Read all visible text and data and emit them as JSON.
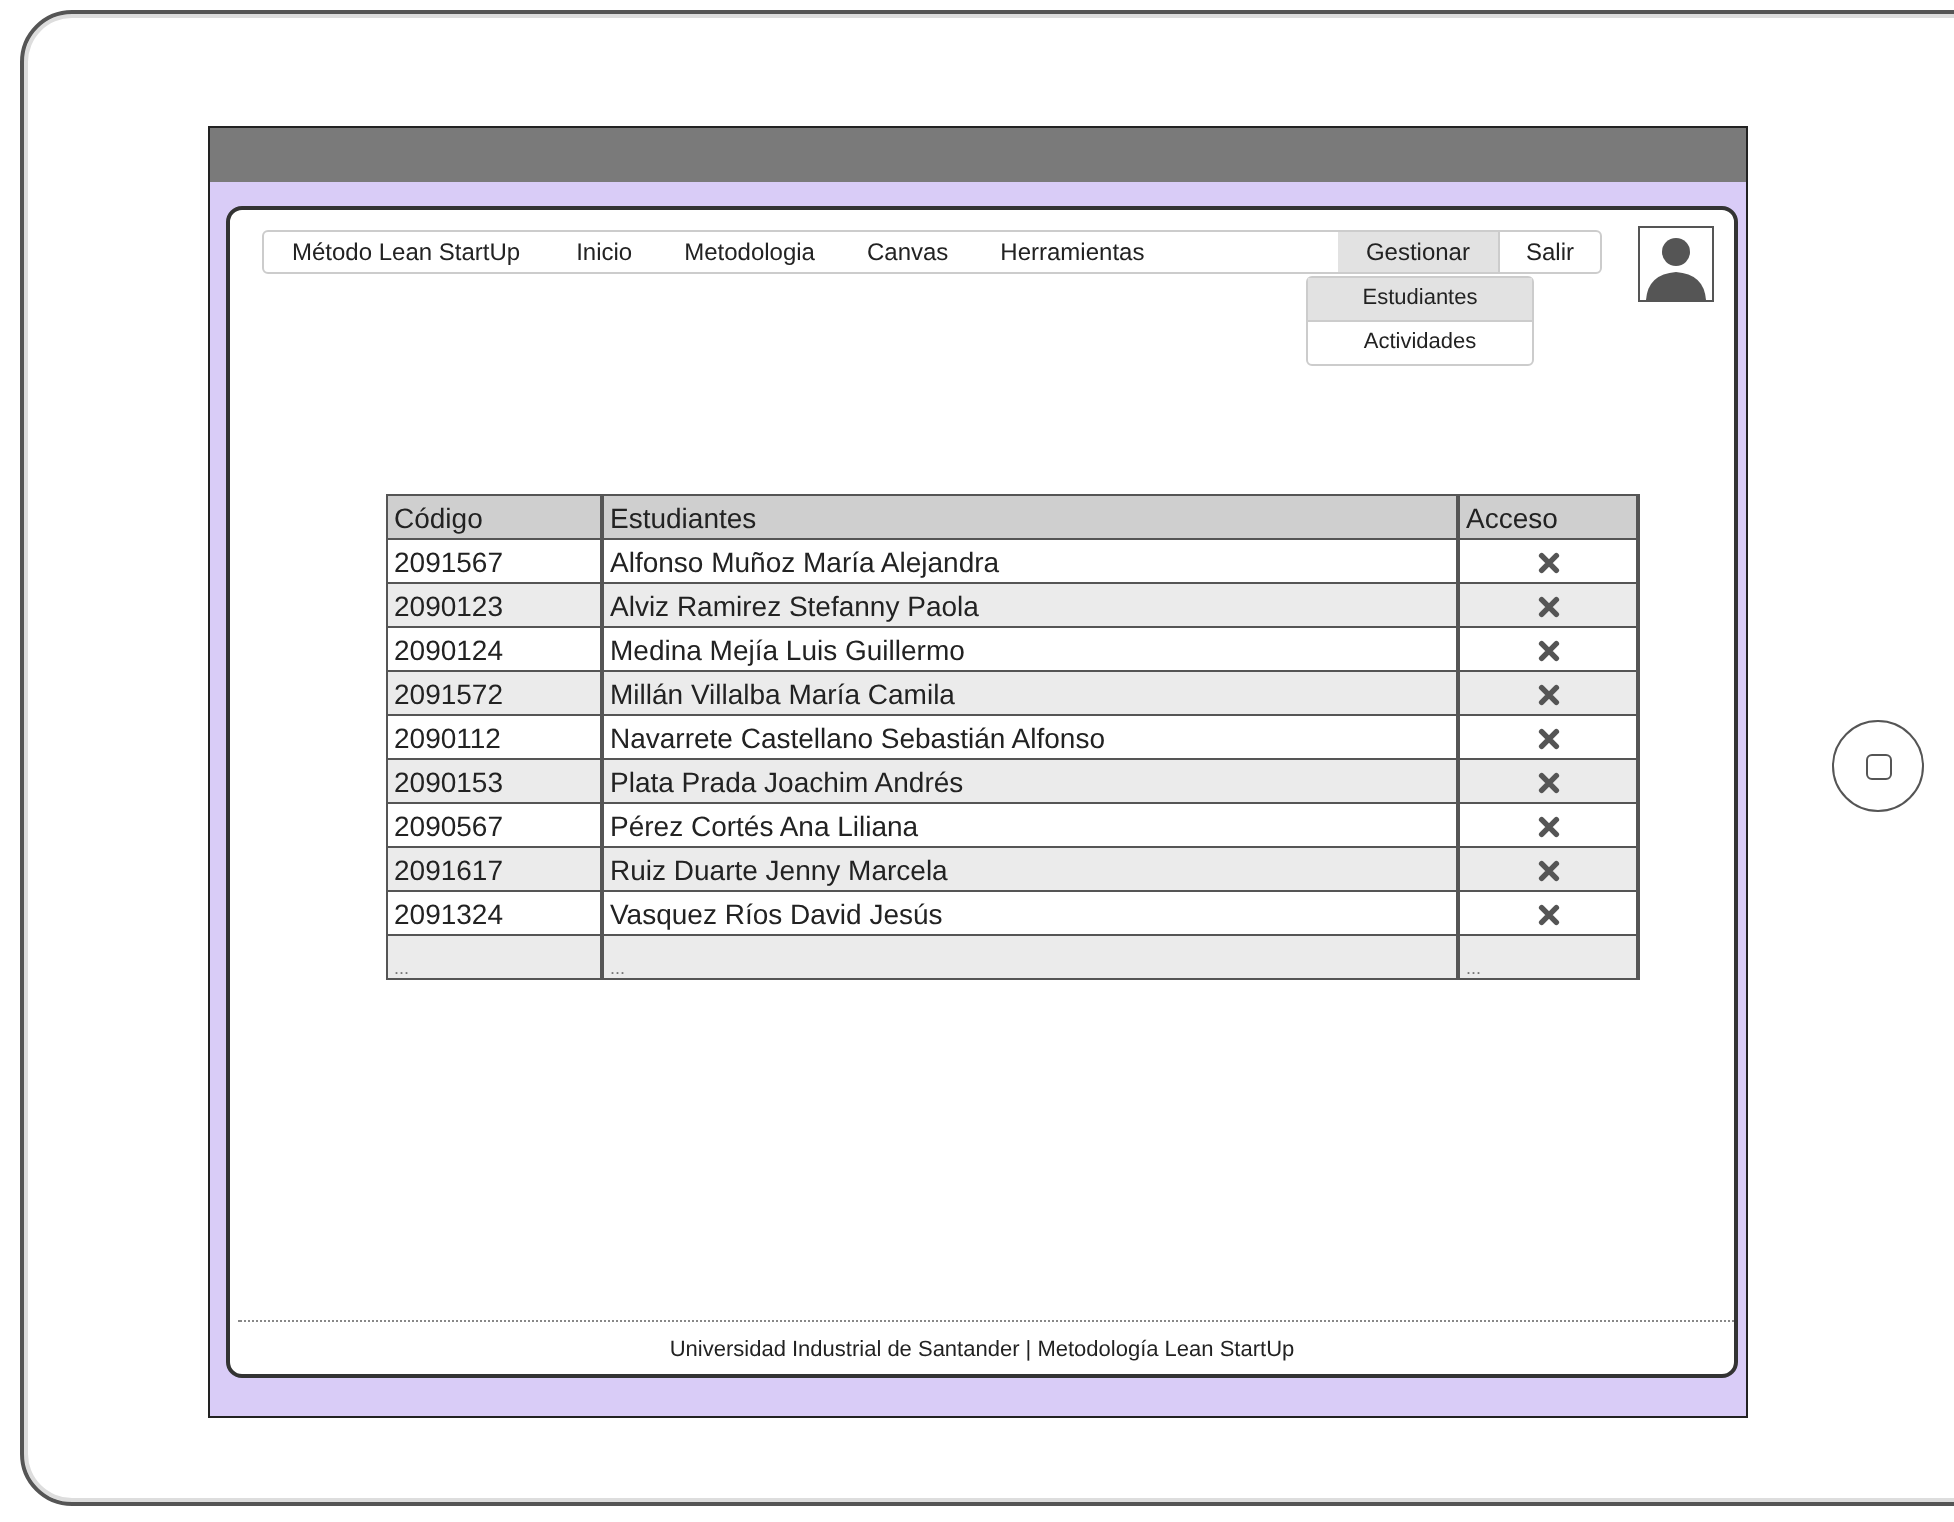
{
  "nav": {
    "brand": "Método Lean StartUp",
    "items": [
      {
        "label": "Inicio",
        "selected": false
      },
      {
        "label": "Metodologia",
        "selected": false
      },
      {
        "label": "Canvas",
        "selected": false
      },
      {
        "label": "Herramientas",
        "selected": false
      },
      {
        "label": "Gestionar",
        "selected": true
      },
      {
        "label": "Salir",
        "selected": false
      }
    ]
  },
  "dropdown": [
    {
      "label": "Estudiantes",
      "selected": true
    },
    {
      "label": "Actividades",
      "selected": false
    }
  ],
  "table": {
    "columns": [
      "Código",
      "Estudiantes",
      "Acceso"
    ],
    "rows": [
      {
        "code": "2091567",
        "name": "Alfonso Muñoz María Alejandra",
        "kind": "remove"
      },
      {
        "code": "2090123",
        "name": "Alviz Ramirez Stefanny Paola",
        "kind": "remove"
      },
      {
        "code": "2090124",
        "name": "Medina Mejía Luis Guillermo",
        "kind": "remove"
      },
      {
        "code": "2091572",
        "name": "Millán Villalba María Camila",
        "kind": "remove"
      },
      {
        "code": "2090112",
        "name": "Navarrete Castellano Sebastián Alfonso",
        "kind": "remove"
      },
      {
        "code": "2090153",
        "name": "Plata Prada Joachim Andrés",
        "kind": "remove"
      },
      {
        "code": "2090567",
        "name": "Pérez Cortés Ana Liliana",
        "kind": "remove"
      },
      {
        "code": "2091617",
        "name": "Ruiz Duarte Jenny Marcela",
        "kind": "remove"
      },
      {
        "code": "2091324",
        "name": "Vasquez Ríos David Jesús",
        "kind": "remove"
      },
      {
        "code": "...",
        "name": "...",
        "kind": "more",
        "access": "..."
      }
    ]
  },
  "footer": "Universidad Industrial de Santander | Metodología Lean StartUp"
}
